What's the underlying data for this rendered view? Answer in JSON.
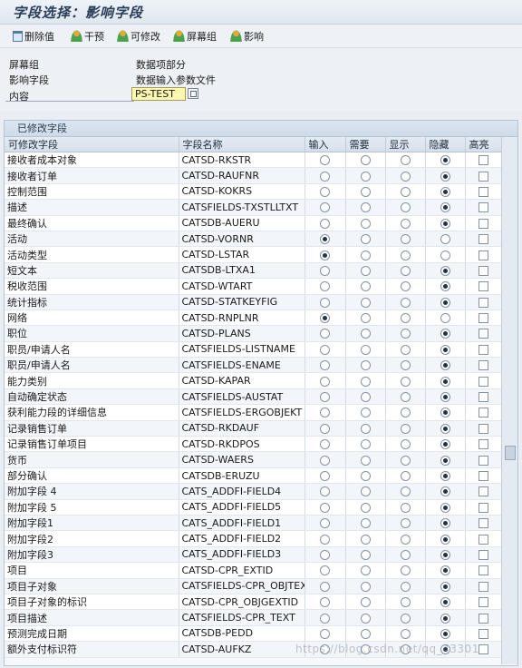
{
  "title": "字段选择：影响字段",
  "toolbar": [
    {
      "label": "删除值",
      "icon": "trash-icon"
    },
    {
      "label": "干预",
      "icon": "person-icon"
    },
    {
      "label": "可修改",
      "icon": "person-icon"
    },
    {
      "label": "屏幕组",
      "icon": "person-icon"
    },
    {
      "label": "影响",
      "icon": "person-icon"
    }
  ],
  "info": {
    "screen_group_label": "屏幕组",
    "screen_group_value": "数据项部分",
    "influence_field_label": "影响字段",
    "influence_field_value": "数据输入参数文件",
    "content_label": "内容",
    "content_value": "PS-TEST"
  },
  "section_title": "已修改字段",
  "columns": [
    "可修改字段",
    "字段名称",
    "输入",
    "需要",
    "显示",
    "隐藏",
    "高亮"
  ],
  "rows": [
    {
      "label": "接收者成本对象",
      "field": "CATSD-RKSTR",
      "sel": 3
    },
    {
      "label": "接收者订单",
      "field": "CATSD-RAUFNR",
      "sel": 3
    },
    {
      "label": "控制范围",
      "field": "CATSD-KOKRS",
      "sel": 3
    },
    {
      "label": "描述",
      "field": "CATSFIELDS-TXSTLLTXT",
      "sel": 3
    },
    {
      "label": "最终确认",
      "field": "CATSDB-AUERU",
      "sel": 3
    },
    {
      "label": "活动",
      "field": "CATSD-VORNR",
      "sel": 0
    },
    {
      "label": "活动类型",
      "field": "CATSD-LSTAR",
      "sel": 0
    },
    {
      "label": "短文本",
      "field": "CATSDB-LTXA1",
      "sel": 3
    },
    {
      "label": "税收范围",
      "field": "CATSD-WTART",
      "sel": 3
    },
    {
      "label": "统计指标",
      "field": "CATSD-STATKEYFIG",
      "sel": 3
    },
    {
      "label": "网络",
      "field": "CATSD-RNPLNR",
      "sel": 0
    },
    {
      "label": "职位",
      "field": "CATSD-PLANS",
      "sel": 3
    },
    {
      "label": "职员/申请人名",
      "field": "CATSFIELDS-LISTNAME",
      "sel": 3
    },
    {
      "label": "职员/申请人名",
      "field": "CATSFIELDS-ENAME",
      "sel": 3
    },
    {
      "label": "能力类别",
      "field": "CATSD-KAPAR",
      "sel": 3
    },
    {
      "label": "自动确定状态",
      "field": "CATSFIELDS-AUSTAT",
      "sel": 3
    },
    {
      "label": "获利能力段的详细信息",
      "field": "CATSFIELDS-ERGOBJEKT",
      "sel": 3
    },
    {
      "label": "记录销售订单",
      "field": "CATSD-RKDAUF",
      "sel": 3
    },
    {
      "label": "记录销售订单项目",
      "field": "CATSD-RKDPOS",
      "sel": 3
    },
    {
      "label": "货币",
      "field": "CATSD-WAERS",
      "sel": 3
    },
    {
      "label": "部分确认",
      "field": "CATSDB-ERUZU",
      "sel": 3
    },
    {
      "label": "附加字段 4",
      "field": "CATS_ADDFI-FIELD4",
      "sel": 3
    },
    {
      "label": "附加字段 5",
      "field": "CATS_ADDFI-FIELD5",
      "sel": 3
    },
    {
      "label": "附加字段1",
      "field": "CATS_ADDFI-FIELD1",
      "sel": 3
    },
    {
      "label": "附加字段2",
      "field": "CATS_ADDFI-FIELD2",
      "sel": 3
    },
    {
      "label": "附加字段3",
      "field": "CATS_ADDFI-FIELD3",
      "sel": 3
    },
    {
      "label": "项目",
      "field": "CATSD-CPR_EXTID",
      "sel": 3
    },
    {
      "label": "项目子对象",
      "field": "CATSFIELDS-CPR_OBJTEXT",
      "sel": 3
    },
    {
      "label": "项目子对象的标识",
      "field": "CATSD-CPR_OBJGEXTID",
      "sel": 3
    },
    {
      "label": "项目描述",
      "field": "CATSFIELDS-CPR_TEXT",
      "sel": 3
    },
    {
      "label": "预测完成日期",
      "field": "CATSDB-PEDD",
      "sel": 3
    },
    {
      "label": "额外支付标识符",
      "field": "CATSD-AUFKZ",
      "sel": 3
    }
  ],
  "watermark": "https://blog.csdn.net/qq_43301"
}
